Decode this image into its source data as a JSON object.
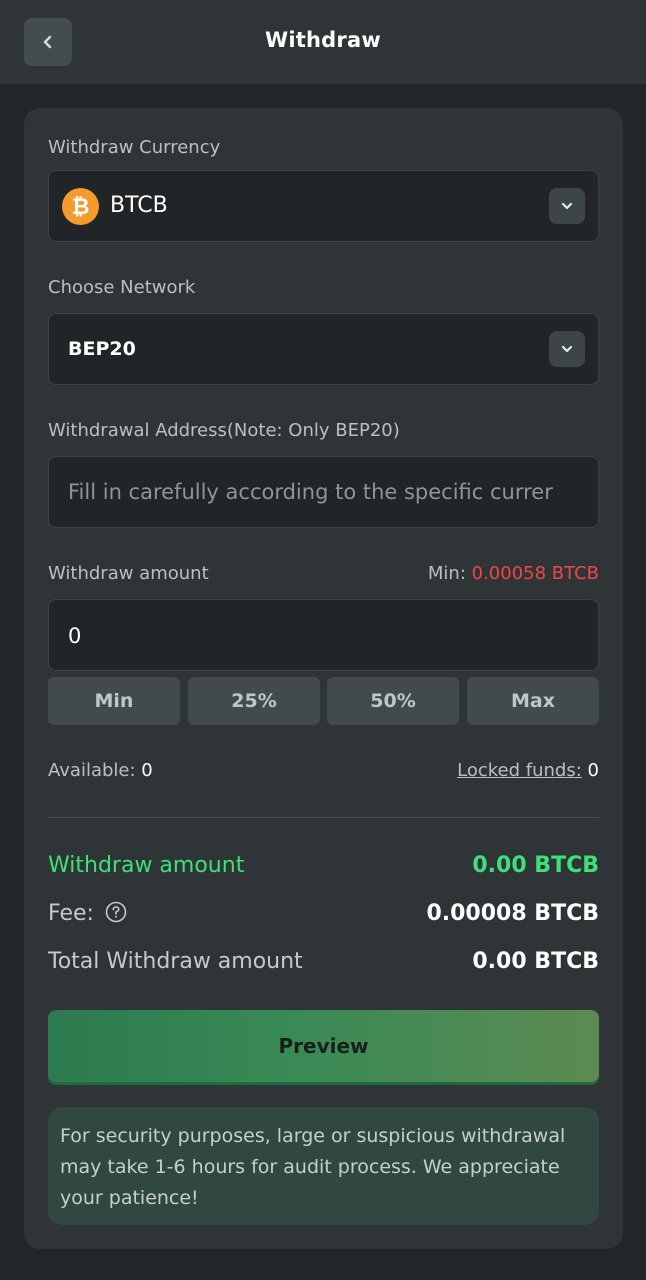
{
  "header": {
    "title": "Withdraw"
  },
  "currency": {
    "label": "Withdraw Currency",
    "value": "BTCB",
    "icon_symbol": "₿",
    "icon_color": "#f59a2c"
  },
  "network": {
    "label": "Choose Network",
    "value": "BEP20"
  },
  "address": {
    "label": "Withdrawal Address(Note: Only BEP20)",
    "placeholder": "Fill in carefully according to the specific currer"
  },
  "amount": {
    "label": "Withdraw amount",
    "min_label": "Min:",
    "min_value": "0.00058 BTCB",
    "value": "0",
    "buttons": [
      "Min",
      "25%",
      "50%",
      "Max"
    ]
  },
  "balance": {
    "available_label": "Available:",
    "available_value": "0",
    "locked_label": "Locked funds:",
    "locked_value": "0"
  },
  "summary": {
    "withdraw_label": "Withdraw amount",
    "withdraw_value": "0.00 BTCB",
    "fee_label": "Fee:",
    "fee_value": "0.00008 BTCB",
    "total_label": "Total Withdraw amount",
    "total_value": "0.00 BTCB"
  },
  "preview_label": "Preview",
  "notice": "For security purposes, large or suspicious withdrawal may take 1-6 hours for audit process. We appreciate your patience!",
  "colors": {
    "accent_green": "#3ee07a",
    "min_red": "#f0454a",
    "background": "#222628",
    "card": "#2f3536"
  }
}
